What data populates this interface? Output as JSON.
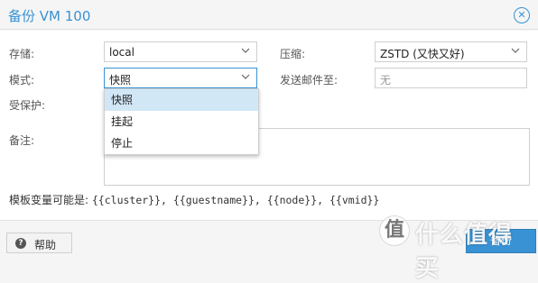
{
  "window": {
    "title": "备份 VM 100"
  },
  "form": {
    "storage": {
      "label": "存储:",
      "value": "local"
    },
    "compression": {
      "label": "压缩:",
      "value": "ZSTD (又快又好)"
    },
    "mode": {
      "label": "模式:",
      "value": "快照"
    },
    "send_email": {
      "label": "发送邮件至:",
      "placeholder": "无"
    },
    "protected": {
      "label": "受保护:"
    },
    "notes": {
      "label": "备注:"
    },
    "template_vars": {
      "label": "模板变量可能是:",
      "value": "{{cluster}}, {{guestname}}, {{node}}, {{vmid}}"
    }
  },
  "mode_dropdown": {
    "options": [
      "快照",
      "挂起",
      "停止"
    ],
    "selected_index": 0
  },
  "footer": {
    "help_label": "帮助",
    "backup_label": "备份"
  },
  "watermark": {
    "text": "什么值得买",
    "logo_char": "值"
  },
  "colors": {
    "accent": "#3892d4",
    "selected_option_bg": "#d1e7f6"
  }
}
